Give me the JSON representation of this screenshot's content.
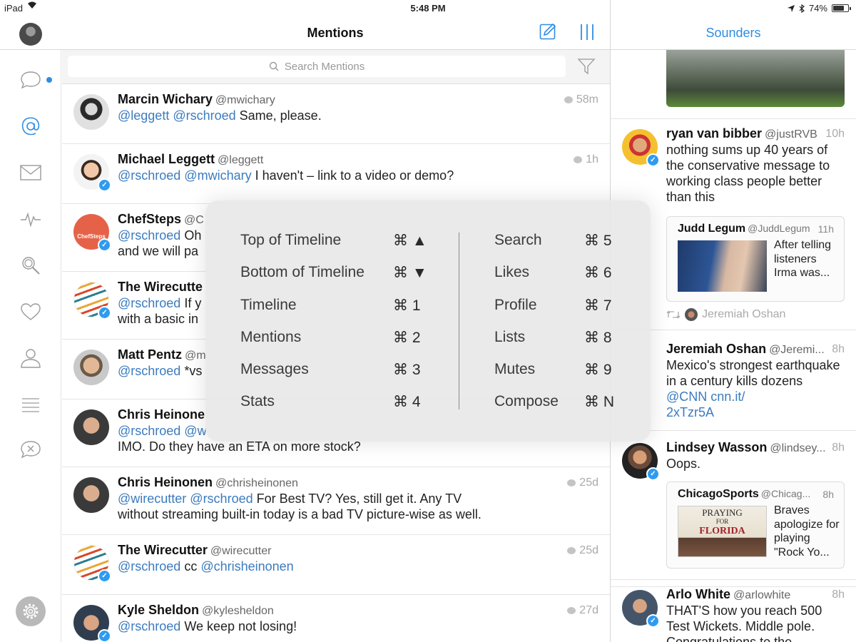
{
  "status_bar": {
    "device": "iPad",
    "time": "5:48 PM",
    "battery": "74%",
    "battery_level": 0.74
  },
  "header": {
    "title": "Mentions"
  },
  "right_header": {
    "title": "Sounders"
  },
  "sidebar": {
    "items": [
      "messages",
      "mentions",
      "direct-messages",
      "activity",
      "search",
      "likes",
      "profile",
      "lists",
      "mutes"
    ]
  },
  "search": {
    "placeholder": "Search Mentions"
  },
  "tweets": [
    {
      "name": "Marcin Wichary",
      "handle": "@mwichary",
      "time": "58m",
      "mentions": "@leggett @rschroed",
      "text": " Same, please."
    },
    {
      "name": "Michael Leggett",
      "handle": "@leggett",
      "time": "1h",
      "mentions": "@rschroed @mwichary",
      "text": " I haven't – link to a video or demo?"
    },
    {
      "name": "ChefSteps",
      "handle": "@C",
      "time": "",
      "mentions": "@rschroed",
      "text": " Oh",
      "line2": "and we will pa",
      "avatar_text": "ChefSteps"
    },
    {
      "name": "The Wirecutte",
      "handle": "",
      "time": "",
      "mentions": "@rschroed",
      "text": " If y",
      "line2": "with a basic in"
    },
    {
      "name": "Matt Pentz",
      "handle": "@m",
      "time": "",
      "mentions": "@rschroed",
      "text": " *vs"
    },
    {
      "name": "Chris Heinone",
      "handle": "",
      "time": "",
      "mentions": "@rschroed @w",
      "text": "",
      "line2": "IMO. Do they have an ETA on more stock?"
    },
    {
      "name": "Chris Heinonen",
      "handle": "@chrisheinonen",
      "time": "25d",
      "mentions": "@wirecutter @rschroed",
      "text": " For Best TV? Yes, still get it. Any TV",
      "line2": "without streaming built-in today is a bad TV picture-wise as well."
    },
    {
      "name": "The Wirecutter",
      "handle": "@wirecutter",
      "time": "25d",
      "mentions": "@rschroed",
      "text": " cc ",
      "mention2": "@chrisheinonen"
    },
    {
      "name": "Kyle Sheldon",
      "handle": "@kylesheldon",
      "time": "27d",
      "mentions": "@rschroed",
      "text": " We keep not losing!"
    }
  ],
  "right_tweets": [
    {
      "name": "ryan van bibber",
      "handle": "@justRVB",
      "time": "10h",
      "text": "nothing sums up 40 years of the conservative message to working class people better than this",
      "quote": {
        "name": "Judd Legum",
        "handle": "@JuddLegum",
        "time": "11h",
        "text": "After telling listeners Irma was..."
      },
      "retweeted_by": "Jeremiah Oshan"
    },
    {
      "name": "Jeremiah Oshan",
      "handle": "@Jeremi...",
      "time": "8h",
      "text": "Mexico's strongest earthquake in a century kills dozens ",
      "link1": "@CNN",
      "link2": "cnn.it/",
      "link3": "2xTzr5A"
    },
    {
      "name": "Lindsey Wasson",
      "handle": "@lindsey...",
      "time": "8h",
      "text": "Oops.",
      "quote": {
        "name": "ChicagoSports",
        "handle": "@Chicag...",
        "time": "8h",
        "text": "Braves apologize for playing \"Rock Yo...",
        "sign_top": "PRAYING",
        "sign_mid": "FOR",
        "sign_bottom": "FLORIDA"
      }
    },
    {
      "name": "Arlo White",
      "handle": "@arlowhite",
      "time": "8h",
      "text": "THAT'S how you reach 500 Test Wickets. Middle pole. Congratulations to the"
    }
  ],
  "shortcuts": {
    "left": [
      {
        "label": "Top of Timeline",
        "key": "⌘ ▲"
      },
      {
        "label": "Bottom of Timeline",
        "key": "⌘ ▼"
      },
      {
        "label": "Timeline",
        "key": "⌘ 1"
      },
      {
        "label": "Mentions",
        "key": "⌘ 2"
      },
      {
        "label": "Messages",
        "key": "⌘ 3"
      },
      {
        "label": "Stats",
        "key": "⌘ 4"
      }
    ],
    "right": [
      {
        "label": "Search",
        "key": "⌘ 5"
      },
      {
        "label": "Likes",
        "key": "⌘ 6"
      },
      {
        "label": "Profile",
        "key": "⌘ 7"
      },
      {
        "label": "Lists",
        "key": "⌘ 8"
      },
      {
        "label": "Mutes",
        "key": "⌘ 9"
      },
      {
        "label": "Compose",
        "key": "⌘ N"
      }
    ]
  },
  "colors": {
    "accent": "#2f8de4",
    "mention": "#3b7bbf",
    "verified": "#2f9bf0"
  }
}
